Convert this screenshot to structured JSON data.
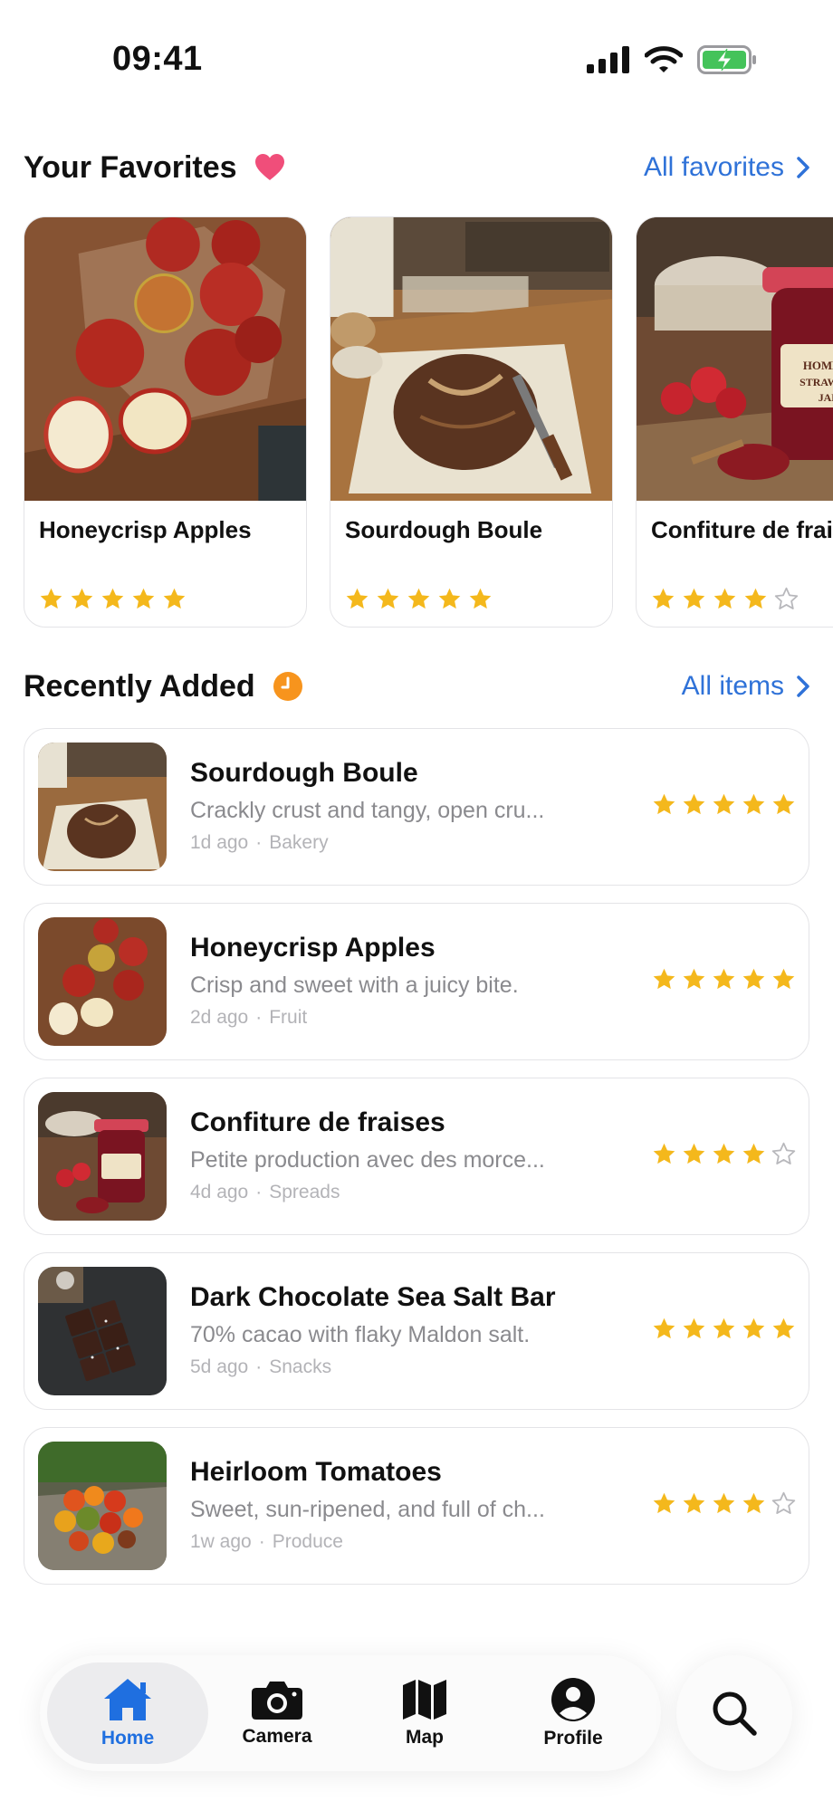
{
  "status_bar": {
    "time": "09:41"
  },
  "favorites": {
    "title": "Your Favorites",
    "link": "All favorites",
    "items": [
      {
        "name": "Honeycrisp Apples",
        "rating": 5
      },
      {
        "name": "Sourdough Boule",
        "rating": 5
      },
      {
        "name": "Confiture de fraises",
        "rating": 4
      }
    ]
  },
  "recent": {
    "title": "Recently Added",
    "link": "All items",
    "items": [
      {
        "title": "Sourdough Boule",
        "desc": "Crackly crust and tangy, open cru...",
        "age": "1d ago",
        "category": "Bakery",
        "rating": 5
      },
      {
        "title": "Honeycrisp Apples",
        "desc": "Crisp and sweet with a juicy bite.",
        "age": "2d ago",
        "category": "Fruit",
        "rating": 5
      },
      {
        "title": "Confiture de fraises",
        "desc": "Petite production avec des morce...",
        "age": "4d ago",
        "category": "Spreads",
        "rating": 4
      },
      {
        "title": "Dark Chocolate Sea Salt Bar",
        "desc": "70% cacao with flaky Maldon salt.",
        "age": "5d ago",
        "category": "Snacks",
        "rating": 5
      },
      {
        "title": "Heirloom Tomatoes",
        "desc": "Sweet, sun-ripened, and full of ch...",
        "age": "1w ago",
        "category": "Produce",
        "rating": 4
      }
    ]
  },
  "tabbar": {
    "home": "Home",
    "camera": "Camera",
    "map": "Map",
    "profile": "Profile"
  },
  "colors": {
    "accent": "#2f72d8",
    "star": "#f4b81c",
    "heart": "#f04e7a",
    "clock": "#f7941d"
  }
}
